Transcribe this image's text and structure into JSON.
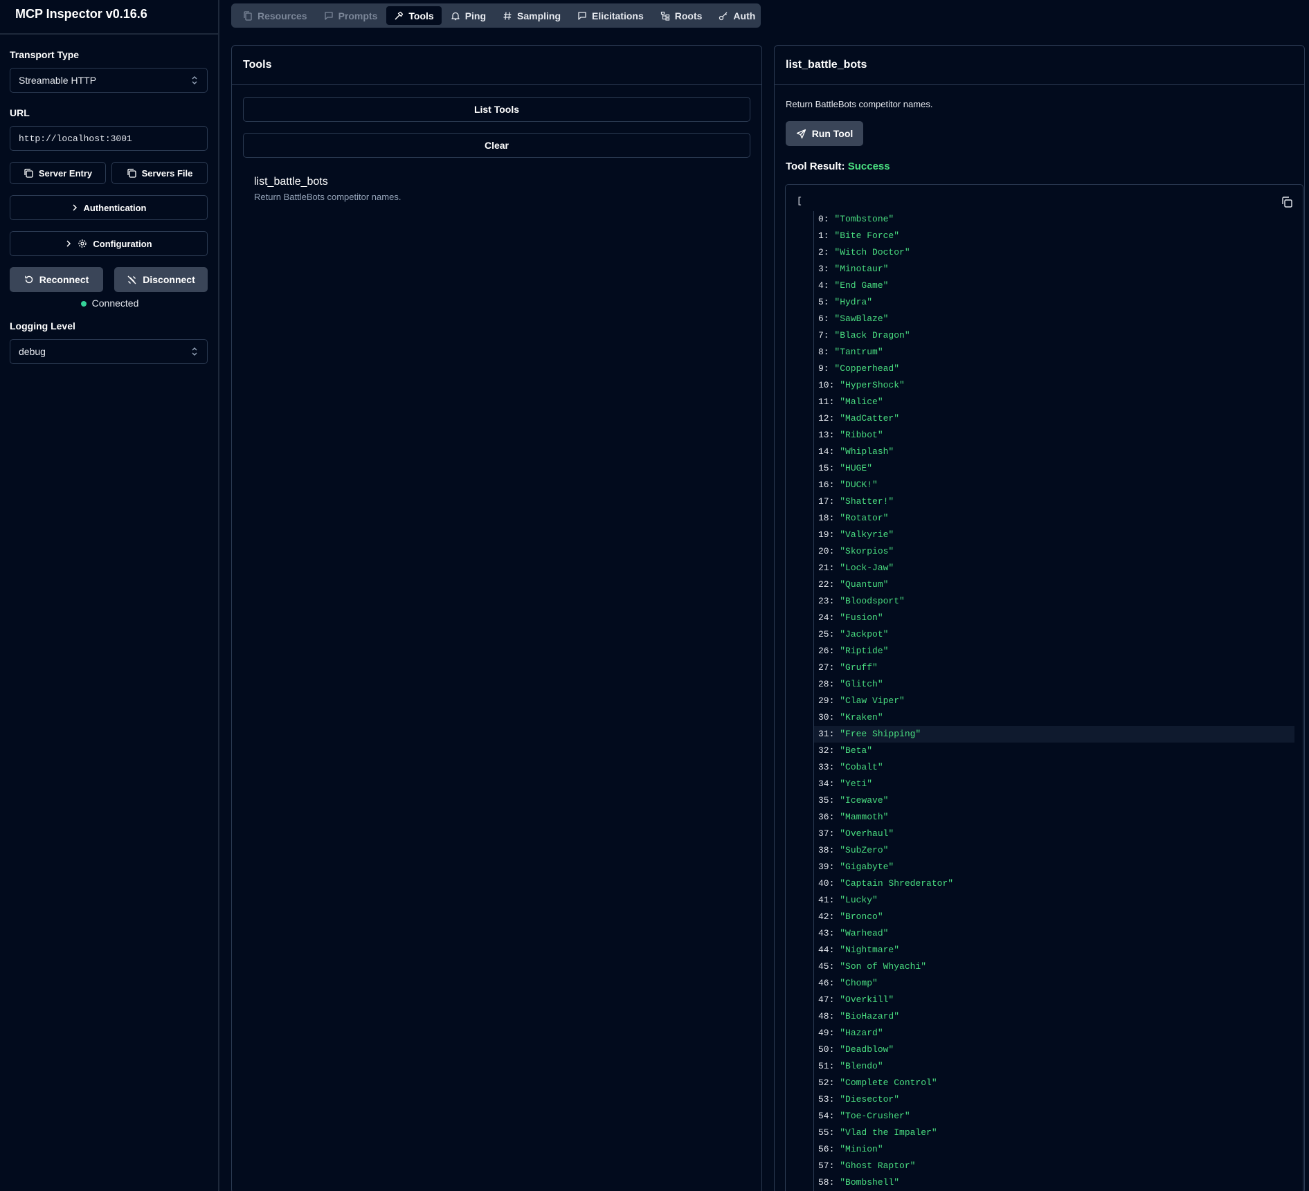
{
  "app": {
    "title": "MCP Inspector v0.16.6"
  },
  "sidebar": {
    "transport_label": "Transport Type",
    "transport_value": "Streamable HTTP",
    "url_label": "URL",
    "url_value": "http://localhost:3001",
    "server_entry": "Server Entry",
    "servers_file": "Servers File",
    "authentication": "Authentication",
    "configuration": "Configuration",
    "reconnect": "Reconnect",
    "disconnect": "Disconnect",
    "status": "Connected",
    "logging_label": "Logging Level",
    "logging_value": "debug"
  },
  "tabs": [
    {
      "label": "Resources",
      "icon": "files-icon",
      "state": "disabled"
    },
    {
      "label": "Prompts",
      "icon": "message-icon",
      "state": "disabled"
    },
    {
      "label": "Tools",
      "icon": "hammer-icon",
      "state": "active"
    },
    {
      "label": "Ping",
      "icon": "bell-icon",
      "state": "normal"
    },
    {
      "label": "Sampling",
      "icon": "hash-icon",
      "state": "normal"
    },
    {
      "label": "Elicitations",
      "icon": "message-icon",
      "state": "normal"
    },
    {
      "label": "Roots",
      "icon": "folder-tree-icon",
      "state": "normal"
    },
    {
      "label": "Auth",
      "icon": "key-icon",
      "state": "normal"
    }
  ],
  "tools_panel": {
    "title": "Tools",
    "list_tools": "List Tools",
    "clear": "Clear",
    "tool_name": "list_battle_bots",
    "tool_desc": "Return BattleBots competitor names."
  },
  "detail_panel": {
    "title": "list_battle_bots",
    "desc": "Return BattleBots competitor names.",
    "run_tool": "Run Tool",
    "result_label": "Tool Result:",
    "result_status": "Success",
    "open_bracket": "[",
    "highlighted_index": 31,
    "items": [
      "Tombstone",
      "Bite Force",
      "Witch Doctor",
      "Minotaur",
      "End Game",
      "Hydra",
      "SawBlaze",
      "Black Dragon",
      "Tantrum",
      "Copperhead",
      "HyperShock",
      "Malice",
      "MadCatter",
      "Ribbot",
      "Whiplash",
      "HUGE",
      "DUCK!",
      "Shatter!",
      "Rotator",
      "Valkyrie",
      "Skorpios",
      "Lock-Jaw",
      "Quantum",
      "Bloodsport",
      "Fusion",
      "Jackpot",
      "Riptide",
      "Gruff",
      "Glitch",
      "Claw Viper",
      "Kraken",
      "Free Shipping",
      "Beta",
      "Cobalt",
      "Yeti",
      "Icewave",
      "Mammoth",
      "Overhaul",
      "SubZero",
      "Gigabyte",
      "Captain Shrederator",
      "Lucky",
      "Bronco",
      "Warhead",
      "Nightmare",
      "Son of Whyachi",
      "Chomp",
      "Overkill",
      "BioHazard",
      "Hazard",
      "Deadblow",
      "Blendo",
      "Complete Control",
      "Diesector",
      "Toe-Crusher",
      "Vlad the Impaler",
      "Minion",
      "Ghost Raptor",
      "Bombshell"
    ]
  },
  "colors": {
    "background": "#020b1d",
    "success": "#4ade80",
    "connected_dot": "#34d399"
  }
}
